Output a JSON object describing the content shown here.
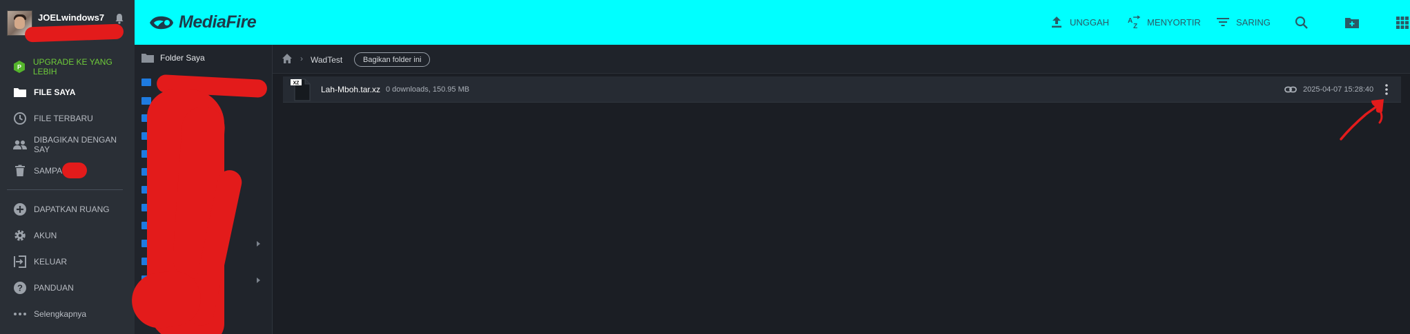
{
  "sidebar": {
    "username": "JOELwindows7",
    "items": [
      {
        "label": "UPGRADE KE YANG LEBIH",
        "icon": "upgrade-badge-icon"
      },
      {
        "label": "FILE SAYA",
        "icon": "folder-icon"
      },
      {
        "label": "FILE TERBARU",
        "icon": "clock-icon"
      },
      {
        "label": "DIBAGIKAN DENGAN SAY",
        "icon": "people-icon"
      },
      {
        "label": "SAMPAH",
        "icon": "trash-icon"
      },
      {
        "label": "DAPATKAN RUANG",
        "icon": "plus-circle-icon"
      },
      {
        "label": "AKUN",
        "icon": "gear-icon"
      },
      {
        "label": "KELUAR",
        "icon": "logout-icon"
      },
      {
        "label": "PANDUAN",
        "icon": "help-icon"
      },
      {
        "label": "Selengkapnya",
        "icon": "more-horizontal-icon"
      }
    ],
    "upgrade_badge": "P"
  },
  "header": {
    "logo": "MediaFire",
    "tools": [
      {
        "label": "UNGGAH",
        "icon": "upload-icon"
      },
      {
        "label": "MENYORTIR",
        "icon": "sort-az-icon"
      },
      {
        "label": "SARING",
        "icon": "filter-icon"
      }
    ],
    "icon_buttons": [
      "search-icon",
      "new-folder-icon",
      "grid-view-icon"
    ]
  },
  "folder_panel": {
    "root_label": "Folder Saya"
  },
  "breadcrumb": {
    "separator": "›",
    "current": "WadTest",
    "share_button": "Bagikan folder ini"
  },
  "files": [
    {
      "type_badge": "XZ",
      "name": "Lah-Mboh.tar.xz",
      "meta": "0 downloads, 150.95 MB",
      "date": "2025-04-07 15:28:40"
    }
  ],
  "colors": {
    "header_bg": "#00ffff",
    "sidebar_bg": "#2a2f36",
    "content_bg": "#1b1e24",
    "upgrade_green": "#6ecb3a",
    "folder_blue": "#1e7be0",
    "redaction_red": "#e31b1b"
  }
}
